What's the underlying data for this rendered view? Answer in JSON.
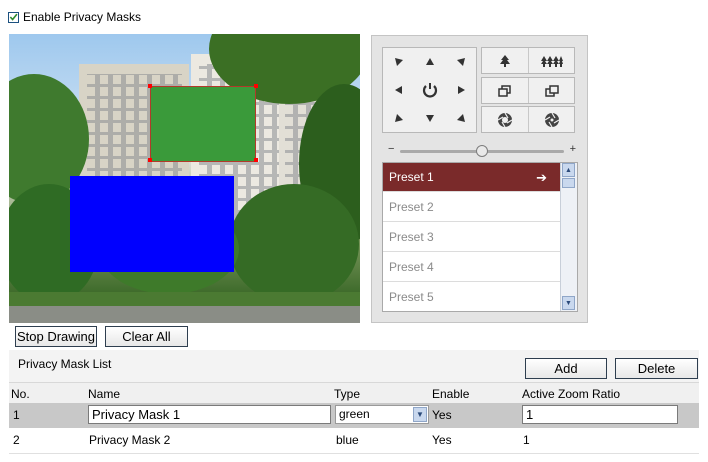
{
  "enable_checkbox": {
    "label": "Enable Privacy Masks",
    "checked": true
  },
  "video": {
    "masks": [
      {
        "name": "Privacy Mask 1",
        "color": "#3a9a3a",
        "selected": true
      },
      {
        "name": "Privacy Mask 2",
        "color": "#0000ff",
        "selected": false
      }
    ]
  },
  "ptz": {
    "direction_icons": [
      "up-left-arrow-icon",
      "up-arrow-icon",
      "up-right-arrow-icon",
      "left-arrow-icon",
      "auto-rotate-icon",
      "right-arrow-icon",
      "down-left-arrow-icon",
      "down-arrow-icon",
      "down-right-arrow-icon"
    ],
    "controls": [
      "zoom-in-icon",
      "zoom-out-icon",
      "focus-near-icon",
      "focus-far-icon",
      "iris-open-icon",
      "iris-close-icon"
    ],
    "presets": [
      "Preset 1",
      "Preset 2",
      "Preset 3",
      "Preset 4",
      "Preset 5"
    ],
    "selected_preset": "Preset 1",
    "accent": "#7a2a2a"
  },
  "drawing": {
    "stop_label": "Stop Drawing",
    "clear_label": "Clear All"
  },
  "mask_list": {
    "title": "Privacy Mask List",
    "add_label": "Add",
    "delete_label": "Delete",
    "columns": {
      "no": "No.",
      "name": "Name",
      "type": "Type",
      "enable": "Enable",
      "zoom": "Active Zoom Ratio"
    },
    "rows": [
      {
        "no": "1",
        "name": "Privacy Mask 1",
        "type": "green",
        "enable": "Yes",
        "zoom": "1"
      },
      {
        "no": "2",
        "name": "Privacy Mask 2",
        "type": "blue",
        "enable": "Yes",
        "zoom": "1"
      }
    ]
  }
}
